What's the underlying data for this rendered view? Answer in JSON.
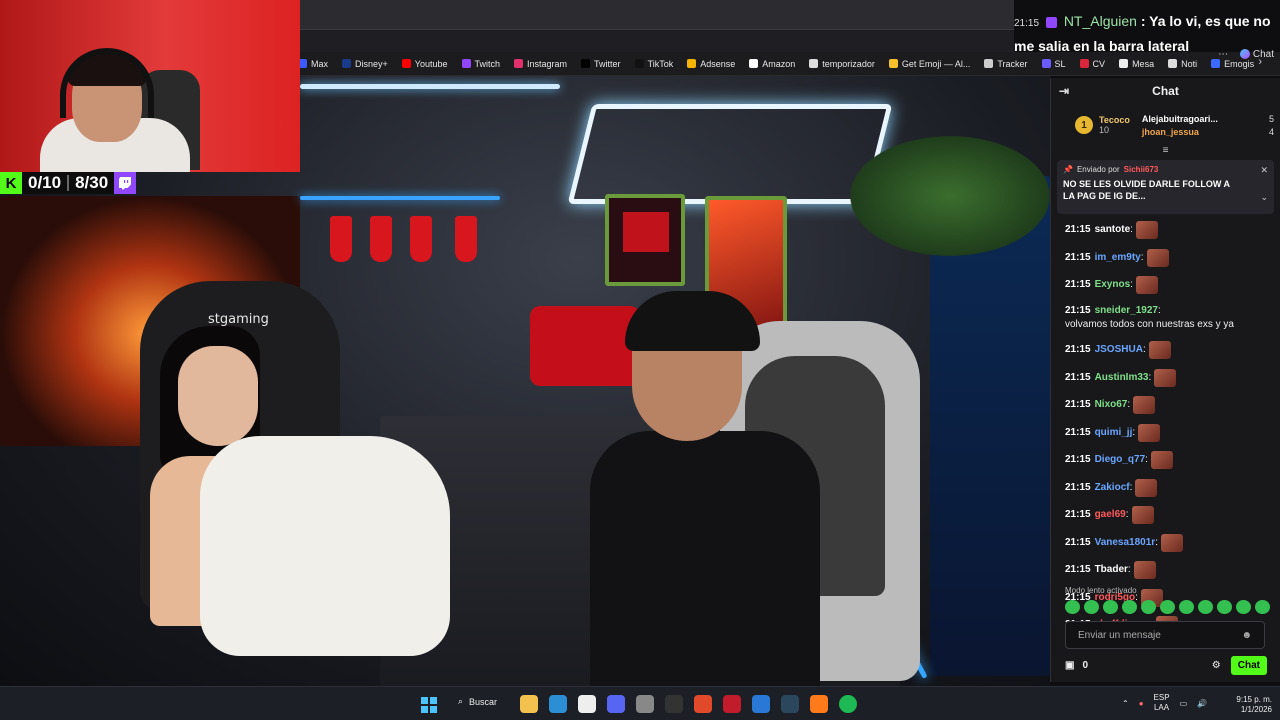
{
  "notification": {
    "time": "21:15",
    "user": "NT_Alguien",
    "line1": ": Ya lo vi, es que no",
    "line2": "me salia en la barra lateral",
    "chat_label": "Chat"
  },
  "bookmarks": [
    {
      "label": "Max",
      "icon": "max-icon",
      "color": "#3b5bff"
    },
    {
      "label": "Disney+",
      "icon": "disney-icon",
      "color": "#1a3a8a"
    },
    {
      "label": "Youtube",
      "icon": "youtube-icon",
      "color": "#ff0000"
    },
    {
      "label": "Twitch",
      "icon": "twitch-icon",
      "color": "#9146ff"
    },
    {
      "label": "Instagram",
      "icon": "instagram-icon",
      "color": "#e1306c"
    },
    {
      "label": "Twitter",
      "icon": "x-icon",
      "color": "#000000"
    },
    {
      "label": "TikTok",
      "icon": "tiktok-icon",
      "color": "#111111"
    },
    {
      "label": "Adsense",
      "icon": "adsense-icon",
      "color": "#f4b400"
    },
    {
      "label": "Amazon",
      "icon": "amazon-icon",
      "color": "#ffffff"
    },
    {
      "label": "temporizador",
      "icon": "timer-icon",
      "color": "#dddddd"
    },
    {
      "label": "Get Emoji — Al...",
      "icon": "emoji-icon",
      "color": "#f6c02b"
    },
    {
      "label": "Tracker",
      "icon": "tracker-icon",
      "color": "#cccccc"
    },
    {
      "label": "SL",
      "icon": "sl-icon",
      "color": "#6a5aff"
    },
    {
      "label": "CV",
      "icon": "cv-icon",
      "color": "#d9263a"
    },
    {
      "label": "Mesa",
      "icon": "mesa-icon",
      "color": "#eeeeee"
    },
    {
      "label": "Noti",
      "icon": "noti-icon",
      "color": "#dddddd"
    },
    {
      "label": "Emogis",
      "icon": "emogis-icon",
      "color": "#3a6aff"
    }
  ],
  "counters": {
    "kick": "0/10",
    "twitch": "8/30"
  },
  "video": {
    "chair_brand": "stgaming"
  },
  "chat": {
    "title": "Chat",
    "leaderboard": {
      "top1": {
        "rank": "1",
        "name": "Tecoco",
        "points": "10"
      },
      "others": [
        {
          "name": "Alejabuitragoari...",
          "points": "5"
        },
        {
          "name": "jhoan_jessua",
          "points": "4"
        }
      ]
    },
    "pinned": {
      "label": "Enviado por",
      "sender": "Sichii673",
      "message": "NO SE LES OLVIDE DARLE FOLLOW A LA PAG DE IG DE..."
    },
    "messages": [
      {
        "time": "21:15",
        "user": "santote",
        "color": "#ffffff",
        "text": "",
        "emote": true
      },
      {
        "time": "21:15",
        "user": "im_em9ty",
        "color": "#6aa6ff",
        "text": "",
        "emote": true
      },
      {
        "time": "21:15",
        "user": "Exynos",
        "color": "#7fe08a",
        "text": "",
        "emote": true
      },
      {
        "time": "21:15",
        "user": "sneider_1927",
        "color": "#7fe08a",
        "text": "volvamos todos con nuestras exs y ya",
        "emote": false
      },
      {
        "time": "21:15",
        "user": "JSOSHUA",
        "color": "#6aa6ff",
        "text": "",
        "emote": true
      },
      {
        "time": "21:15",
        "user": "AustinIm33",
        "color": "#7fe08a",
        "text": "",
        "emote": true
      },
      {
        "time": "21:15",
        "user": "Nixo67",
        "color": "#7fe08a",
        "text": "",
        "emote": true
      },
      {
        "time": "21:15",
        "user": "quimi_jj",
        "color": "#6aa6ff",
        "text": "",
        "emote": true
      },
      {
        "time": "21:15",
        "user": "Diego_q77",
        "color": "#6aa6ff",
        "text": "",
        "emote": true
      },
      {
        "time": "21:15",
        "user": "Zakiocf",
        "color": "#6aa6ff",
        "text": "",
        "emote": true
      },
      {
        "time": "21:15",
        "user": "gael69",
        "color": "#ff5a5a",
        "text": "",
        "emote": true
      },
      {
        "time": "21:15",
        "user": "Vanesa1801r",
        "color": "#6aa6ff",
        "text": "",
        "emote": true
      },
      {
        "time": "21:15",
        "user": "Tbader",
        "color": "#ffffff",
        "text": "",
        "emote": true
      },
      {
        "time": "21:15",
        "user": "rodri5go",
        "color": "#ff5a5a",
        "text": "",
        "emote": true
      },
      {
        "time": "21:15",
        "user": "cheffdiegox",
        "color": "#ff5a5a",
        "text": "",
        "emote": true
      }
    ],
    "slow_mode": "Modo lento activado",
    "input_placeholder": "Enviar un mensaje",
    "points": "0",
    "send_label": "Chat"
  },
  "taskbar": {
    "search_label": "Buscar",
    "lang_line1": "ESP",
    "lang_line2": "LAA",
    "time": "9:15 p. m.",
    "date": "1/1/2026"
  }
}
